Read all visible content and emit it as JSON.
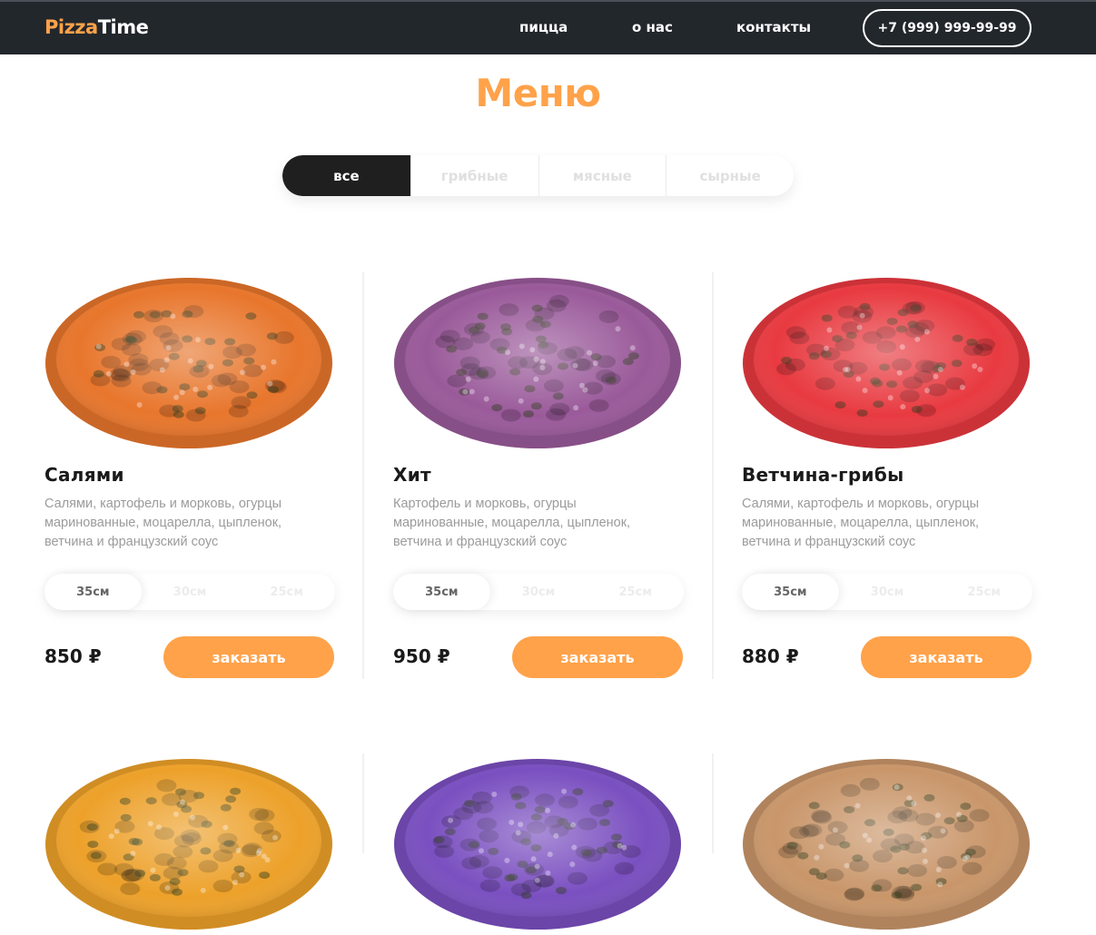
{
  "header": {
    "logo_part1": "Pizza",
    "logo_part2": "Time",
    "nav": [
      "пицца",
      "о нас",
      "контакты"
    ],
    "phone": "+7 (999) 999-99-99"
  },
  "title": "Меню",
  "filters": {
    "items": [
      "все",
      "грибные",
      "мясные",
      "сырные"
    ],
    "active": "все"
  },
  "sizes": [
    "35см",
    "30см",
    "25см"
  ],
  "order_label": "заказать",
  "products": [
    {
      "name": "Салями",
      "description": "Салями, картофель и морковь, огурцы маринованные, моцарелла, цыпленок, ветчина и французский соус",
      "price": "850 ₽",
      "selected_size": "35см",
      "tint": "#e8762c"
    },
    {
      "name": "Хит",
      "description": "Картофель и морковь, огурцы маринованные, моцарелла, цыпленок, ветчина и французский соус",
      "price": "950 ₽",
      "selected_size": "35см",
      "tint": "#9a5a9a"
    },
    {
      "name": "Ветчина-грибы",
      "description": "Салями, картофель и морковь, огурцы маринованные, моцарелла, цыпленок, ветчина и французский соус",
      "price": "880 ₽",
      "selected_size": "35см",
      "tint": "#e83a40"
    }
  ],
  "second_row_tints": [
    "#eda12a",
    "#7a4fc0",
    "#c9966a"
  ],
  "colors": {
    "accent": "#ffa24a",
    "header_bg": "#22272c",
    "dark_tab": "#1f1f1f"
  }
}
